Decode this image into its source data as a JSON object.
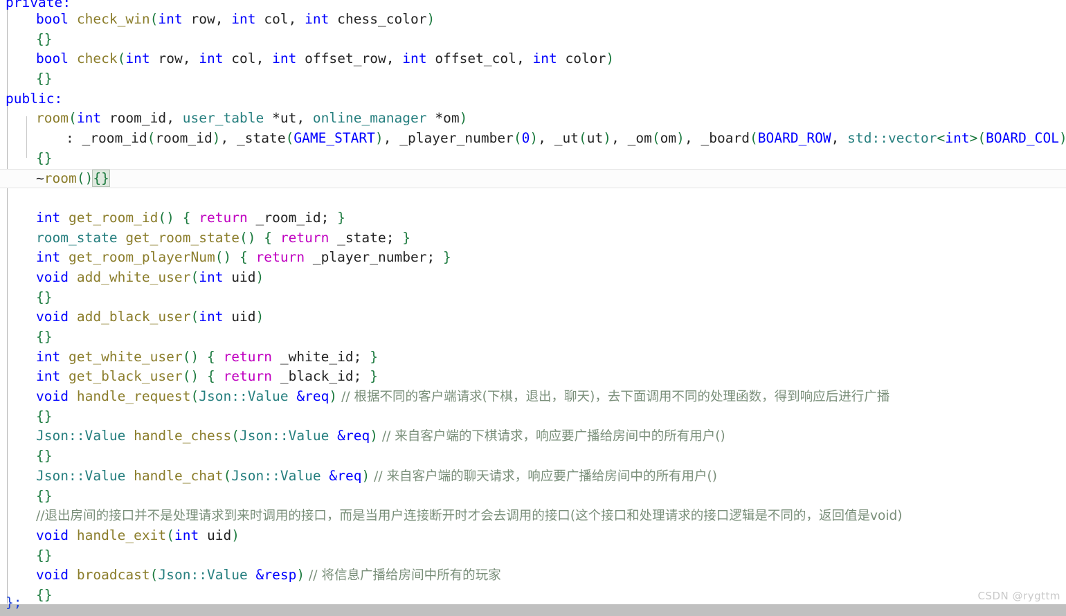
{
  "editor": {
    "language": "C++",
    "watermark": "CSDN @rygttm",
    "colors": {
      "background": "#ffffff",
      "keyword": "#0000ff",
      "function": "#8b7d2b",
      "type": "#267f7f",
      "bracket": "#1b7a3e",
      "return_keyword": "#c000c0",
      "macro": "#0000ff",
      "comment": "#7a8f7a",
      "identifier": "#242424",
      "current_line_border": "#e3e3e3",
      "brace_match_highlight": "#dfe9df",
      "scrollbar": "#c0c0c0",
      "watermark": "#c9c9c9"
    }
  },
  "code": {
    "l00_private": "private:",
    "l01_kw": "bool",
    "l01_fn": "check_win",
    "l01_p1": "(",
    "l01_t1": "int",
    "l01_a1": " row",
    "l01_c1": ", ",
    "l01_t2": "int",
    "l01_a2": " col",
    "l01_c2": ", ",
    "l01_t3": "int",
    "l01_a3": " chess_color",
    "l01_p2": ")",
    "l02_braces": "{}",
    "l03_kw": "bool",
    "l03_fn": "check",
    "l03_p1": "(",
    "l03_t1": "int",
    "l03_a1": " row",
    "l03_c1": ", ",
    "l03_t2": "int",
    "l03_a2": " col",
    "l03_c2": ", ",
    "l03_t3": "int",
    "l03_a3": " offset_row",
    "l03_c3": ", ",
    "l03_t4": "int",
    "l03_a4": " offset_col",
    "l03_c4": ", ",
    "l03_t5": "int",
    "l03_a5": " color",
    "l03_p2": ")",
    "l04_braces": "{}",
    "l05_public": "public:",
    "l06_fn": "room",
    "l06_p1": "(",
    "l06_t1": "int",
    "l06_a1": " room_id",
    "l06_c1": ", ",
    "l06_t2": "user_table",
    "l06_s1": " *",
    "l06_a2": "ut",
    "l06_c2": ", ",
    "l06_t3": "online_manager",
    "l06_s2": " *",
    "l06_a3": "om",
    "l06_p2": ")",
    "l07_colon": ": ",
    "l07_m1": "_room_id",
    "l07_o1": "(",
    "l07_v1": "room_id",
    "l07_o2": ")",
    "l07_c1": ", ",
    "l07_m2": "_state",
    "l07_o3": "(",
    "l07_v2": "GAME_START",
    "l07_o4": ")",
    "l07_c2": ", ",
    "l07_m3": "_player_number",
    "l07_o5": "(",
    "l07_v3": "0",
    "l07_o6": ")",
    "l07_c3": ", ",
    "l07_m4": "_ut",
    "l07_o7": "(",
    "l07_v4": "ut",
    "l07_o8": ")",
    "l07_c4": ", ",
    "l07_m5": "_om",
    "l07_o9": "(",
    "l07_v5": "om",
    "l07_o10": ")",
    "l07_c5": ", ",
    "l07_m6": "_board",
    "l07_o11": "(",
    "l07_v6": "BOARD_ROW",
    "l07_c6": ", ",
    "l07_t7": "std::vector",
    "l07_lt": "<",
    "l07_v7": "int",
    "l07_gt": ">",
    "l07_o12": "(",
    "l07_v8": "BOARD_COL",
    "l07_o13": "))",
    "l08_braces": "{}",
    "l09_tilde": "~",
    "l09_fn": "room",
    "l09_p": "()",
    "l09_braces": "{}",
    "l11_t": "int",
    "l11_fn": "get_room_id",
    "l11_p": "() ",
    "l11_ob": "{ ",
    "l11_ret": "return",
    "l11_v": " _room_id",
    "l11_sc": "; ",
    "l11_cb": "}",
    "l12_t": "room_state",
    "l12_fn": "get_room_state",
    "l12_p": "() ",
    "l12_ob": "{ ",
    "l12_ret": "return",
    "l12_v": " _state",
    "l12_sc": "; ",
    "l12_cb": "}",
    "l13_t": "int",
    "l13_fn": "get_room_playerNum",
    "l13_p": "() ",
    "l13_ob": "{ ",
    "l13_ret": "return",
    "l13_v": " _player_number",
    "l13_sc": "; ",
    "l13_cb": "}",
    "l14_t": "void",
    "l14_fn": "add_white_user",
    "l14_p1": "(",
    "l14_t2": "int",
    "l14_a": " uid",
    "l14_p2": ")",
    "l15_braces": "{}",
    "l16_t": "void",
    "l16_fn": "add_black_user",
    "l16_p1": "(",
    "l16_t2": "int",
    "l16_a": " uid",
    "l16_p2": ")",
    "l17_braces": "{}",
    "l18_t": "int",
    "l18_fn": "get_white_user",
    "l18_p": "() ",
    "l18_ob": "{ ",
    "l18_ret": "return",
    "l18_v": " _white_id",
    "l18_sc": "; ",
    "l18_cb": "}",
    "l19_t": "int",
    "l19_fn": "get_black_user",
    "l19_p": "() ",
    "l19_ob": "{ ",
    "l19_ret": "return",
    "l19_v": " _black_id",
    "l19_sc": "; ",
    "l19_cb": "}",
    "l20_t": "void",
    "l20_fn": "handle_request",
    "l20_p1": "(",
    "l20_t2": "Json::Value",
    "l20_amp": " &",
    "l20_a": "req",
    "l20_p2": ")",
    "l20_cmt": " // 根据不同的客户端请求(下棋，退出，聊天)，去下面调用不同的处理函数，得到响应后进行广播",
    "l21_braces": "{}",
    "l22_t": "Json::Value",
    "l22_fn": "handle_chess",
    "l22_p1": "(",
    "l22_t2": "Json::Value",
    "l22_amp": " &",
    "l22_a": "req",
    "l22_p2": ")",
    "l22_cmt": " // 来自客户端的下棋请求，响应要广播给房间中的所有用户()",
    "l23_braces": "{}",
    "l24_t": "Json::Value",
    "l24_fn": "handle_chat",
    "l24_p1": "(",
    "l24_t2": "Json::Value",
    "l24_amp": " &",
    "l24_a": "req",
    "l24_p2": ")",
    "l24_cmt": " // 来自客户端的聊天请求，响应要广播给房间中的所有用户()",
    "l25_braces": "{}",
    "l26_cmt": "//退出房间的接口并不是处理请求到来时调用的接口，而是当用户连接断开时才会去调用的接口(这个接口和处理请求的接口逻辑是不同的，返回值是void)",
    "l27_t": "void",
    "l27_fn": "handle_exit",
    "l27_p1": "(",
    "l27_t2": "int",
    "l27_a": " uid",
    "l27_p2": ")",
    "l28_braces": "{}",
    "l29_t": "void",
    "l29_fn": "broadcast",
    "l29_p1": "(",
    "l29_t2": "Json::Value",
    "l29_amp": " &",
    "l29_a": "resp",
    "l29_p2": ")",
    "l29_cmt": " // 将信息广播给房间中所有的玩家",
    "l30_braces": "{}",
    "l31_close": "};"
  }
}
